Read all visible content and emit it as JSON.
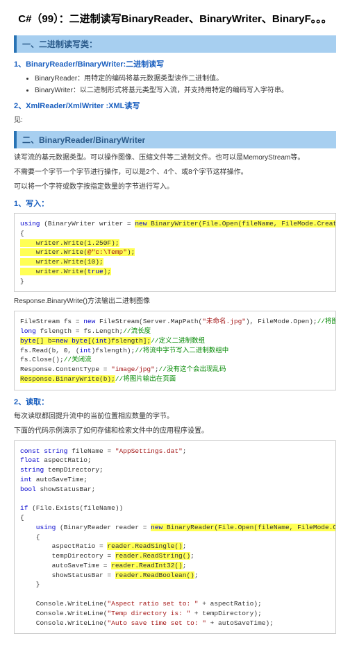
{
  "title": "C#（99）：二进制读写BinaryReader、BinaryWriter、BinaryF。。。",
  "sec1": {
    "heading": "一、二进制读写类：",
    "sub1": {
      "heading": "1、BinaryReader/BinaryWriter:二进制读写",
      "b1": "BinaryReader：用特定的编码将基元数据类型读作二进制值。",
      "b2": "BinaryWriter：以二进制形式将基元类型写入流，并支持用特定的编码写入字符串。"
    },
    "sub2": {
      "heading": "2、XmlReader/XmlWriter :XML读写",
      "text": "见:"
    }
  },
  "sec2": {
    "heading": "二、BinaryReader/BinaryWriter",
    "p1": "读写流的基元数据类型。可以操作图像、压缩文件等二进制文件。也可以是MemoryStream等。",
    "p2": "不需要一个字节一个字节进行操作，可以是2个、4个、或8个字节这样操作。",
    "p3": "可以将一个字符或数字按指定数量的字节进行写入。"
  },
  "write": {
    "heading": "1、写入：",
    "code1": {
      "l1a": "using",
      "l1b": " (BinaryWriter writer = ",
      "l1c": "new",
      "l1d": " BinaryWriter(File.Open(fileName, FileMode.Create)))",
      "l2": "{",
      "l3": "    writer.Write(1.250F);",
      "l4a": "    writer.Write(",
      "l4b": "@\"c:\\Temp\"",
      "l4c": ");",
      "l5": "    writer.Write(10);",
      "l6a": "    writer.Write(",
      "l6b": "true",
      "l6c": ");",
      "l7": "}"
    },
    "mid": "Response.BinaryWrite()方法输出二进制图像",
    "code2": {
      "l1a": "FileStream fs = ",
      "l1b": "new",
      "l1c": " FileStream(Server.MapPath(",
      "l1d": "\"未命名.jpg\"",
      "l1e": "), FileMode.Open);",
      "l1f": "//将图片文件存在文件流中",
      "l2a": "long",
      "l2b": " fslength = fs.Length;",
      "l2c": "//流长度",
      "l3a": "byte",
      "l3b": "[] b=",
      "l3c": "new",
      "l3d": " ",
      "l3e": "byte",
      "l3f": "[(",
      "l3g": "int",
      "l3h": ")fslength];",
      "l3i": "//定义二进制数组",
      "l4a": "fs.Read(b, 0, (",
      "l4b": "int",
      "l4c": ")fslength);",
      "l4d": "//将流中字节写入二进制数组中",
      "l5a": "fs.Close();",
      "l5b": "//关闭流",
      "l6a": "Response.ContentType = ",
      "l6b": "\"image/jpg\"",
      "l6c": ";",
      "l6d": "//没有这个会出现乱码",
      "l7a": "Response.BinaryWrite(b);",
      "l7b": "//将图片输出在页面"
    }
  },
  "read": {
    "heading": "2、读取：",
    "p1": "每次读取都回提升流中的当前位置相应数量的字节。",
    "p2": "下面的代码示例演示了如何存储和检索文件中的应用程序设置。",
    "code": {
      "l1a": "const",
      "l1b": " ",
      "l1c": "string",
      "l1d": " fileName = ",
      "l1e": "\"AppSettings.dat\"",
      "l1f": ";",
      "l2a": "float",
      "l2b": " aspectRatio;",
      "l3a": "string",
      "l3b": " tempDirectory;",
      "l4a": "int",
      "l4b": " autoSaveTime;",
      "l5a": "bool",
      "l5b": " showStatusBar;",
      "l6": "",
      "l7a": "if",
      "l7b": " (File.Exists(fileName))",
      "l8": "{",
      "l9a": "    using",
      "l9b": " (BinaryReader reader = ",
      "l9c": "new",
      "l9d": " BinaryReader(File.Open(fileName, FileMode.Open)))",
      "l10": "    {",
      "l11a": "        aspectRatio = ",
      "l11b": "reader.ReadSingle()",
      "l11c": ";",
      "l12a": "        tempDirectory = ",
      "l12b": "reader.ReadString()",
      "l12c": ";",
      "l13a": "        autoSaveTime = ",
      "l13b": "reader.ReadInt32()",
      "l13c": ";",
      "l14a": "        showStatusBar = ",
      "l14b": "reader.ReadBoolean()",
      "l14c": ";",
      "l15": "    }",
      "l16": "",
      "l17a": "    Console.WriteLine(",
      "l17b": "\"Aspect ratio set to: \"",
      "l17c": " + aspectRatio);",
      "l18a": "    Console.WriteLine(",
      "l18b": "\"Temp directory is: \"",
      "l18c": " + tempDirectory);",
      "l19a": "    Console.WriteLine(",
      "l19b": "\"Auto save time set to: \"",
      "l19c": " + autoSaveTime);"
    }
  }
}
